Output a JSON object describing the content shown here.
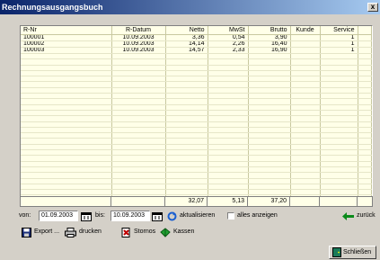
{
  "window": {
    "title": "Rechnungsausgangsbuch",
    "close_label": "x"
  },
  "grid": {
    "columns": [
      "R-Nr",
      "R-Datum",
      "Netto",
      "MwSt",
      "Brutto",
      "Kunde",
      "Service"
    ],
    "rows": [
      [
        "100001",
        "10.09.2003",
        "3,36",
        "0,54",
        "3,90",
        "",
        "1"
      ],
      [
        "100002",
        "10.09.2003",
        "14,14",
        "2,26",
        "16,40",
        "",
        "1"
      ],
      [
        "100003",
        "10.09.2003",
        "14,57",
        "2,33",
        "16,90",
        "",
        "1"
      ]
    ],
    "totals": [
      "",
      "",
      "32,07",
      "5,13",
      "37,20",
      "",
      ""
    ]
  },
  "filter": {
    "from_label": "von:",
    "from_value": "01.09.2003",
    "to_label": "bis:",
    "to_value": "10.09.2003",
    "refresh_label": "aktualisieren",
    "show_all_label": "alles anzeigen",
    "back_label": "zurück"
  },
  "actions": {
    "export_label": "Export ...",
    "print_label": "drucken",
    "storno_label": "Stornos",
    "kassen_label": "Kassen",
    "close_label": "Schließen"
  },
  "icons": {
    "calendar": "calendar-icon",
    "refresh": "refresh-icon",
    "back": "arrow-left-icon",
    "export": "disk-icon",
    "print": "printer-icon",
    "storno": "storno-icon",
    "kassen": "cash-register-icon",
    "close": "door-icon"
  }
}
